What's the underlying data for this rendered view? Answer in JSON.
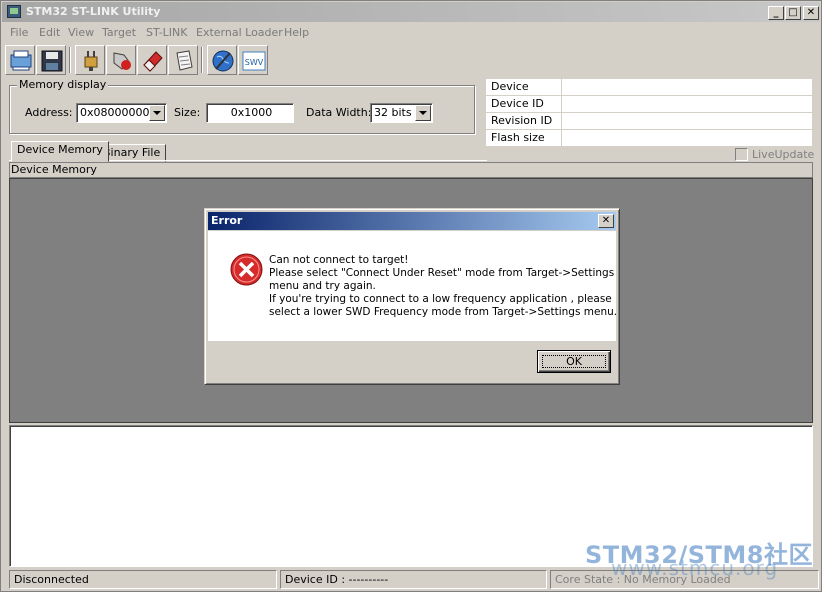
{
  "window": {
    "title": "STM32 ST-LINK Utility",
    "minimize_glyph": "_",
    "maximize_glyph": "□",
    "close_glyph": "✕"
  },
  "menu": [
    "File",
    "Edit",
    "View",
    "Target",
    "ST-LINK",
    "External Loader",
    "Help"
  ],
  "toolbar": {
    "icons": [
      "connect-icon",
      "save-icon",
      "plug-icon",
      "disconnect-icon",
      "erase-icon",
      "verify-icon",
      "program-icon",
      "swv-icon"
    ],
    "swv_label": "SWV"
  },
  "memory_display": {
    "legend": "Memory display",
    "address_label": "Address:",
    "address_value": "0x08000000",
    "size_label": "Size:",
    "size_value": "0x1000",
    "data_width_label": "Data Width:",
    "data_width_value": "32 bits"
  },
  "device_info": {
    "rows": [
      "Device",
      "Device ID",
      "Revision ID",
      "Flash size"
    ]
  },
  "tabs": [
    "Device Memory",
    "Binary File"
  ],
  "live_update": "LiveUpdate",
  "device_memory_header": "Device Memory",
  "status": {
    "connection": "Disconnected",
    "device_id": "Device ID : ----------",
    "core_state": "Core State : No Memory Loaded"
  },
  "dialog": {
    "title": "Error",
    "close_glyph": "✕",
    "lines": [
      "Can not connect to target!",
      "Please select \"Connect Under Reset\" mode from Target->Settings",
      "menu and try again.",
      "If you're trying to connect to a low frequency application , please",
      "select a lower SWD Frequency mode from Target->Settings menu."
    ],
    "ok_label": "OK"
  },
  "watermark": {
    "line1": "STM32/STM8社区",
    "line2": "www.stmcu.org"
  },
  "colors": {
    "dialog_title_start": "#0a246a",
    "dialog_title_end": "#a6caf0",
    "error_red": "#d52b2b",
    "workspace_gray": "#808080"
  }
}
